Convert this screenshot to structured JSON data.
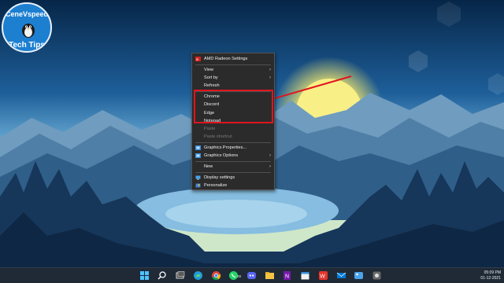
{
  "logo": {
    "line1": "CeneVspeed",
    "line2": "Tech Tips"
  },
  "context_menu": {
    "items": [
      {
        "label": "AMD Radeon Settings",
        "icon": "amd-icon",
        "submenu": false,
        "disabled": false
      },
      {
        "label": "View",
        "submenu": true,
        "disabled": false
      },
      {
        "label": "Sort by",
        "submenu": true,
        "disabled": false
      },
      {
        "label": "Refresh",
        "submenu": false,
        "disabled": false
      },
      {
        "label": "Chrome",
        "submenu": false,
        "disabled": false
      },
      {
        "label": "Discord",
        "submenu": false,
        "disabled": false
      },
      {
        "label": "Edge",
        "submenu": false,
        "disabled": false
      },
      {
        "label": "Notepad",
        "submenu": false,
        "disabled": false
      },
      {
        "label": "Paste",
        "submenu": false,
        "disabled": true
      },
      {
        "label": "Paste shortcut",
        "submenu": false,
        "disabled": true
      },
      {
        "label": "Graphics Properties...",
        "icon": "intel-graphics-icon",
        "submenu": false,
        "disabled": false
      },
      {
        "label": "Graphics Options",
        "icon": "intel-graphics-icon",
        "submenu": true,
        "disabled": false
      },
      {
        "label": "New",
        "submenu": true,
        "disabled": false
      },
      {
        "label": "Display settings",
        "icon": "display-icon",
        "submenu": false,
        "disabled": false
      },
      {
        "label": "Personalize",
        "icon": "personalize-icon",
        "submenu": false,
        "disabled": false
      }
    ],
    "highlight_color": "#e0141e"
  },
  "taskbar": {
    "icons": [
      "windows-start-icon",
      "search-icon",
      "task-view-icon",
      "edge-icon",
      "chrome-icon",
      "file-explorer-icon",
      "whatsapp-icon",
      "discord-icon",
      "files-folder-icon",
      "onenote-icon",
      "calendar-icon",
      "wps-office-icon",
      "mail-icon",
      "photos-icon",
      "capture-icon"
    ],
    "whatsapp_badge": "28",
    "clock_time": "05:09 PM",
    "clock_date": "01-12-2021"
  }
}
